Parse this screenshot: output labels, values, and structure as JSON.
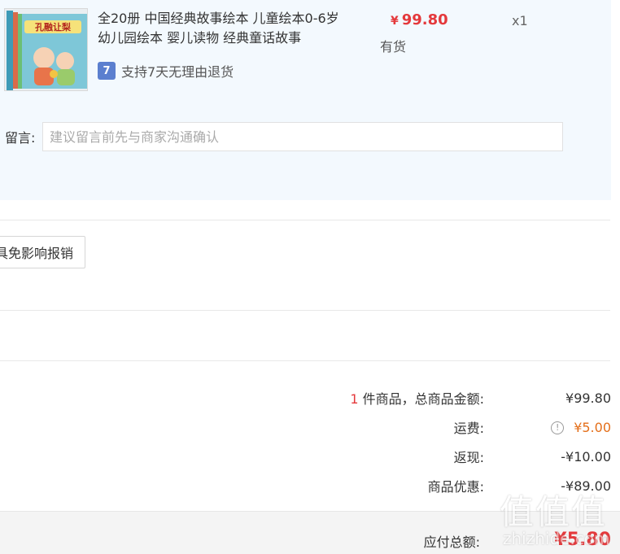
{
  "item": {
    "title": "全20册 中国经典故事绘本 儿童绘本0-6岁 幼儿园绘本 婴儿读物 经典童话故事",
    "thumbnail_caption": "孔融让梨",
    "currency_symbol": "¥",
    "price": "99.80",
    "stock": "有货",
    "quantity": "x1",
    "return_badge": "7",
    "return_policy": "支持7天无理由退货"
  },
  "message": {
    "label": "留言:",
    "placeholder": "建议留言前先与商家沟通确认"
  },
  "reimburse_button": "具免影响报销",
  "summary": {
    "count": "1",
    "items_label": " 件商品，总商品金额:",
    "items_value": "¥99.80",
    "shipping_label": "运费:",
    "shipping_icon": "info-icon",
    "shipping_value": "¥5.00",
    "cashback_label": "返现:",
    "cashback_value": "-¥10.00",
    "discount_label": "商品优惠:",
    "discount_value": "-¥89.00"
  },
  "total": {
    "label": "应付总额:",
    "value": "¥5.80"
  },
  "watermark": {
    "glyphs": "值值值",
    "text": "zhizhide.com"
  },
  "colors": {
    "price_red": "#e4393c",
    "shipping_orange": "#e46f1a",
    "panel_bg": "#f3f9fe"
  }
}
